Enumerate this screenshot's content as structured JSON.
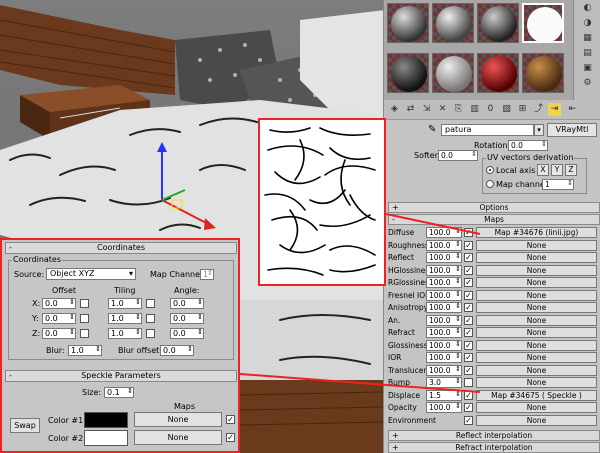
{
  "colors": {
    "accent_frame": "#ee2222",
    "panel_bg": "#c6c6c6",
    "color1": "#000000",
    "color2": "#ffffff"
  },
  "material_editor": {
    "material_name": "patura",
    "material_type": "VRayMtl",
    "rotation": {
      "label": "Rotation",
      "value": "0.0"
    },
    "soften": {
      "label": "Soften",
      "value": "0.0"
    },
    "uv_group": {
      "title": "UV vectors derivation",
      "local_axis": "Local axis",
      "axis_x": "X",
      "axis_y": "Y",
      "axis_z": "Z",
      "map_channel": "Map channel",
      "map_channel_value": "1"
    },
    "rollout_options": "Options",
    "rollout_maps": "Maps",
    "maps": [
      {
        "label": "Diffuse",
        "value": "100.0",
        "checked": true,
        "map": "Map #34676 (linii.jpg)"
      },
      {
        "label": "Roughness",
        "value": "100.0",
        "checked": true,
        "map": "None"
      },
      {
        "label": "Reflect",
        "value": "100.0",
        "checked": true,
        "map": "None"
      },
      {
        "label": "HGlossiness",
        "value": "100.0",
        "checked": true,
        "map": "None"
      },
      {
        "label": "RGlossiness",
        "value": "100.0",
        "checked": true,
        "map": "None"
      },
      {
        "label": "Fresnel IOR",
        "value": "100.0",
        "checked": true,
        "map": "None"
      },
      {
        "label": "Anisotropy",
        "value": "100.0",
        "checked": true,
        "map": "None"
      },
      {
        "label": "An.",
        "value": "100.0",
        "checked": true,
        "map": "None"
      },
      {
        "label": "Refract",
        "value": "100.0",
        "checked": true,
        "map": "None"
      },
      {
        "label": "Glossiness",
        "value": "100.0",
        "checked": true,
        "map": "None"
      },
      {
        "label": "IOR",
        "value": "100.0",
        "checked": true,
        "map": "None"
      },
      {
        "label": "Translucent",
        "value": "100.0",
        "checked": true,
        "map": "None"
      },
      {
        "label": "Bump",
        "value": "3.0",
        "checked": false,
        "map": "None"
      },
      {
        "label": "Displace",
        "value": "1.5",
        "checked": true,
        "map": "Map #34675  ( Speckle )"
      },
      {
        "label": "Opacity",
        "value": "100.0",
        "checked": true,
        "map": "None"
      },
      {
        "label": "Environment",
        "value": "",
        "checked": true,
        "map": "None"
      }
    ],
    "rollout_reflect_interp": "Reflect interpolation",
    "rollout_refract_interp": "Refract interpolation"
  },
  "coordinates_panel": {
    "title": "Coordinates",
    "group_title": "Coordinates",
    "source_label": "Source:",
    "source_value": "Object XYZ",
    "map_channel_label": "Map Channel:",
    "map_channel_value": "1",
    "col_offset": "Offset",
    "col_tiling": "Tiling",
    "col_angle": "Angle:",
    "rows": [
      {
        "axis": "X:",
        "offset": "0.0",
        "tiling": "1.0",
        "angle": "0.0"
      },
      {
        "axis": "Y:",
        "offset": "0.0",
        "tiling": "1.0",
        "angle": "0.0"
      },
      {
        "axis": "Z:",
        "offset": "0.0",
        "tiling": "1.0",
        "angle": "0.0"
      }
    ],
    "blur_label": "Blur:",
    "blur_value": "1.0",
    "blur_offset_label": "Blur offset:",
    "blur_offset_value": "0.0"
  },
  "speckle_panel": {
    "title": "Speckle Parameters",
    "size_label": "Size:",
    "size_value": "0.1",
    "maps_label": "Maps",
    "swap_label": "Swap",
    "color1_label": "Color #1",
    "color2_label": "Color #2",
    "map1": "None",
    "map2": "None"
  }
}
